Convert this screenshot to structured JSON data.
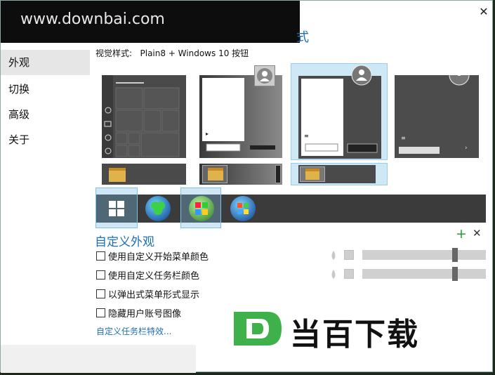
{
  "watermark_text": "www.downbai.com",
  "title_tail": "式",
  "close_glyph": "✕",
  "sidebar": {
    "items": [
      {
        "label": "外观",
        "selected": true
      },
      {
        "label": "切换",
        "selected": false
      },
      {
        "label": "高级",
        "selected": false
      },
      {
        "label": "关于",
        "selected": false
      }
    ]
  },
  "visual_style": {
    "label": "视觉样式:",
    "value": "Plain8 + Windows 10 按钮"
  },
  "custom_appearance": {
    "title": "自定义外观",
    "add_icon": "+",
    "remove_icon": "✕",
    "options": [
      {
        "label": "使用自定义开始菜单颜色",
        "checked": false
      },
      {
        "label": "使用自定义任务栏颜色",
        "checked": false
      },
      {
        "label": "以弹出式菜单形式显示",
        "checked": false
      },
      {
        "label": "隐藏用户账号图像",
        "checked": false
      }
    ],
    "link": "自定义任务栏特效..."
  },
  "brand_text": "当百下载",
  "colors": {
    "accent": "#1f6fb5",
    "selection": "#cfe8f6",
    "plus": "#2a9a3a"
  }
}
